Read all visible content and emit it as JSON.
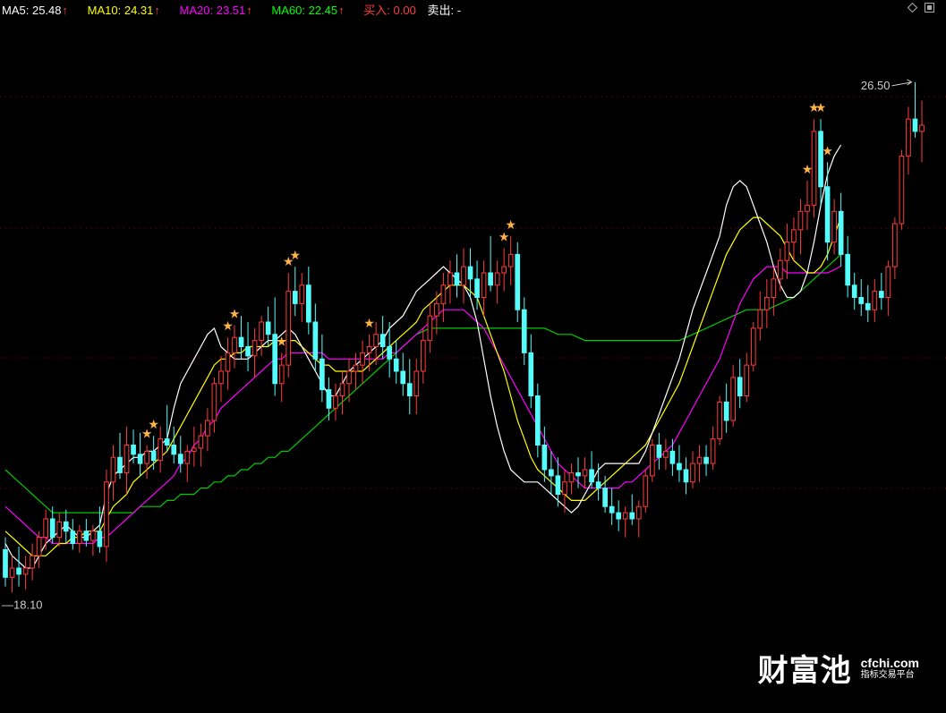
{
  "header": {
    "ma5": {
      "label": "MA5:",
      "value": "25.48",
      "color": "#ffffff"
    },
    "ma10": {
      "label": "MA10:",
      "value": "24.31",
      "color": "#ffff00"
    },
    "ma20": {
      "label": "MA20:",
      "value": "23.51",
      "color": "#ff00ff"
    },
    "ma60": {
      "label": "MA60:",
      "value": "22.45",
      "color": "#00ff00"
    },
    "buy": {
      "label": "买入:",
      "value": "0.00",
      "color": "#ff3b3b"
    },
    "sell": {
      "label": "卖出:",
      "value": "-",
      "color": "#ffffff"
    },
    "arrow_glyph": "↑"
  },
  "watermark": {
    "name": "财富池",
    "site": "cfchi.com",
    "tagline": "指标交易平台"
  },
  "colors": {
    "up": "#ff3b3b",
    "down": "#54fcfc",
    "ma5": "#ffffff",
    "ma10": "#ffff00",
    "ma20": "#ff00ff",
    "ma60": "#00cc00",
    "grid": "#8b0000",
    "marker": "#ffb347"
  },
  "chart_data": {
    "type": "candlestick",
    "high_label": "26.50",
    "low_label": "18.10",
    "ylim": [
      17.8,
      27.4
    ],
    "candles": [
      {
        "o": 18.9,
        "h": 19.1,
        "l": 18.3,
        "c": 18.45
      },
      {
        "o": 18.45,
        "h": 18.8,
        "l": 18.2,
        "c": 18.6
      },
      {
        "o": 18.6,
        "h": 18.95,
        "l": 18.3,
        "c": 18.5
      },
      {
        "o": 18.5,
        "h": 18.8,
        "l": 18.25,
        "c": 18.6
      },
      {
        "o": 18.6,
        "h": 19.0,
        "l": 18.4,
        "c": 18.8
      },
      {
        "o": 18.8,
        "h": 19.2,
        "l": 18.6,
        "c": 19.1
      },
      {
        "o": 19.1,
        "h": 19.55,
        "l": 18.9,
        "c": 19.4
      },
      {
        "o": 19.4,
        "h": 19.6,
        "l": 19.0,
        "c": 19.1
      },
      {
        "o": 19.1,
        "h": 19.5,
        "l": 18.95,
        "c": 19.35
      },
      {
        "o": 19.35,
        "h": 19.55,
        "l": 19.0,
        "c": 19.2
      },
      {
        "o": 19.2,
        "h": 19.4,
        "l": 18.9,
        "c": 19.0
      },
      {
        "o": 19.0,
        "h": 19.3,
        "l": 18.85,
        "c": 19.2
      },
      {
        "o": 19.2,
        "h": 19.4,
        "l": 18.95,
        "c": 19.05
      },
      {
        "o": 19.05,
        "h": 19.3,
        "l": 18.8,
        "c": 19.2
      },
      {
        "o": 19.2,
        "h": 19.6,
        "l": 18.85,
        "c": 18.95
      },
      {
        "o": 18.95,
        "h": 20.2,
        "l": 18.7,
        "c": 20.0
      },
      {
        "o": 20.0,
        "h": 20.6,
        "l": 19.7,
        "c": 20.4
      },
      {
        "o": 20.4,
        "h": 20.8,
        "l": 20.05,
        "c": 20.15
      },
      {
        "o": 20.15,
        "h": 20.9,
        "l": 19.8,
        "c": 20.6
      },
      {
        "o": 20.6,
        "h": 20.85,
        "l": 20.3,
        "c": 20.45
      },
      {
        "o": 20.45,
        "h": 20.8,
        "l": 20.1,
        "c": 20.3
      },
      {
        "o": 20.3,
        "h": 20.6,
        "l": 20.05,
        "c": 20.5
      },
      {
        "o": 20.5,
        "h": 20.75,
        "l": 20.2,
        "c": 20.35
      },
      {
        "o": 20.35,
        "h": 20.9,
        "l": 20.15,
        "c": 20.7
      },
      {
        "o": 20.7,
        "h": 21.25,
        "l": 20.5,
        "c": 20.6
      },
      {
        "o": 20.6,
        "h": 20.9,
        "l": 20.3,
        "c": 20.45
      },
      {
        "o": 20.45,
        "h": 20.75,
        "l": 20.15,
        "c": 20.3
      },
      {
        "o": 20.3,
        "h": 20.6,
        "l": 20.0,
        "c": 20.5
      },
      {
        "o": 20.5,
        "h": 20.9,
        "l": 20.25,
        "c": 20.55
      },
      {
        "o": 20.55,
        "h": 20.95,
        "l": 20.25,
        "c": 20.75
      },
      {
        "o": 20.75,
        "h": 21.2,
        "l": 20.5,
        "c": 21.0
      },
      {
        "o": 21.0,
        "h": 21.7,
        "l": 20.8,
        "c": 21.6
      },
      {
        "o": 21.6,
        "h": 22.05,
        "l": 21.3,
        "c": 21.8
      },
      {
        "o": 21.8,
        "h": 22.35,
        "l": 21.5,
        "c": 22.1
      },
      {
        "o": 22.1,
        "h": 22.55,
        "l": 21.85,
        "c": 22.35
      },
      {
        "o": 22.35,
        "h": 22.7,
        "l": 22.0,
        "c": 22.2
      },
      {
        "o": 22.2,
        "h": 22.6,
        "l": 21.8,
        "c": 22.05
      },
      {
        "o": 22.05,
        "h": 22.5,
        "l": 21.7,
        "c": 22.3
      },
      {
        "o": 22.3,
        "h": 22.7,
        "l": 22.05,
        "c": 22.6
      },
      {
        "o": 22.6,
        "h": 22.85,
        "l": 22.2,
        "c": 22.4
      },
      {
        "o": 22.4,
        "h": 23.0,
        "l": 21.4,
        "c": 21.6
      },
      {
        "o": 21.6,
        "h": 22.1,
        "l": 21.3,
        "c": 21.9
      },
      {
        "o": 21.9,
        "h": 23.4,
        "l": 21.7,
        "c": 23.1
      },
      {
        "o": 23.1,
        "h": 23.5,
        "l": 22.7,
        "c": 22.9
      },
      {
        "o": 22.9,
        "h": 23.4,
        "l": 22.6,
        "c": 23.2
      },
      {
        "o": 23.2,
        "h": 23.5,
        "l": 22.4,
        "c": 22.6
      },
      {
        "o": 22.6,
        "h": 22.9,
        "l": 21.8,
        "c": 22.0
      },
      {
        "o": 22.0,
        "h": 22.4,
        "l": 21.3,
        "c": 21.5
      },
      {
        "o": 21.5,
        "h": 21.7,
        "l": 21.0,
        "c": 21.2
      },
      {
        "o": 21.2,
        "h": 21.6,
        "l": 21.0,
        "c": 21.4
      },
      {
        "o": 21.4,
        "h": 21.8,
        "l": 21.1,
        "c": 21.6
      },
      {
        "o": 21.6,
        "h": 22.0,
        "l": 21.3,
        "c": 21.8
      },
      {
        "o": 21.8,
        "h": 22.1,
        "l": 21.5,
        "c": 21.9
      },
      {
        "o": 21.9,
        "h": 22.3,
        "l": 21.6,
        "c": 22.1
      },
      {
        "o": 22.1,
        "h": 22.4,
        "l": 21.8,
        "c": 22.2
      },
      {
        "o": 22.2,
        "h": 22.6,
        "l": 21.9,
        "c": 22.4
      },
      {
        "o": 22.4,
        "h": 22.7,
        "l": 22.0,
        "c": 22.2
      },
      {
        "o": 22.2,
        "h": 22.6,
        "l": 21.7,
        "c": 22.0
      },
      {
        "o": 22.0,
        "h": 22.3,
        "l": 21.6,
        "c": 21.8
      },
      {
        "o": 21.8,
        "h": 22.1,
        "l": 21.4,
        "c": 21.6
      },
      {
        "o": 21.6,
        "h": 22.0,
        "l": 21.1,
        "c": 21.4
      },
      {
        "o": 21.4,
        "h": 22.0,
        "l": 21.1,
        "c": 21.8
      },
      {
        "o": 21.8,
        "h": 22.5,
        "l": 21.6,
        "c": 22.3
      },
      {
        "o": 22.3,
        "h": 22.9,
        "l": 22.1,
        "c": 22.7
      },
      {
        "o": 22.7,
        "h": 23.1,
        "l": 22.4,
        "c": 22.9
      },
      {
        "o": 22.9,
        "h": 23.4,
        "l": 22.6,
        "c": 23.2
      },
      {
        "o": 23.2,
        "h": 23.6,
        "l": 22.9,
        "c": 23.4
      },
      {
        "o": 23.4,
        "h": 23.7,
        "l": 23.0,
        "c": 23.2
      },
      {
        "o": 23.2,
        "h": 23.8,
        "l": 22.9,
        "c": 23.5
      },
      {
        "o": 23.5,
        "h": 23.8,
        "l": 23.0,
        "c": 23.3
      },
      {
        "o": 23.3,
        "h": 23.6,
        "l": 22.8,
        "c": 23.0
      },
      {
        "o": 23.0,
        "h": 23.6,
        "l": 22.7,
        "c": 23.4
      },
      {
        "o": 23.4,
        "h": 24.0,
        "l": 23.1,
        "c": 23.2
      },
      {
        "o": 23.2,
        "h": 23.6,
        "l": 22.9,
        "c": 23.4
      },
      {
        "o": 23.4,
        "h": 23.8,
        "l": 23.1,
        "c": 23.5
      },
      {
        "o": 23.5,
        "h": 24.0,
        "l": 23.2,
        "c": 23.7
      },
      {
        "o": 23.7,
        "h": 23.9,
        "l": 22.6,
        "c": 22.8
      },
      {
        "o": 22.8,
        "h": 23.0,
        "l": 21.9,
        "c": 22.1
      },
      {
        "o": 22.1,
        "h": 22.4,
        "l": 21.2,
        "c": 21.4
      },
      {
        "o": 21.4,
        "h": 21.6,
        "l": 20.4,
        "c": 20.6
      },
      {
        "o": 20.6,
        "h": 20.9,
        "l": 20.0,
        "c": 20.2
      },
      {
        "o": 20.2,
        "h": 20.5,
        "l": 19.8,
        "c": 20.1
      },
      {
        "o": 20.1,
        "h": 20.4,
        "l": 19.6,
        "c": 19.8
      },
      {
        "o": 19.8,
        "h": 20.2,
        "l": 19.5,
        "c": 20.0
      },
      {
        "o": 20.0,
        "h": 20.3,
        "l": 19.8,
        "c": 20.15
      },
      {
        "o": 20.15,
        "h": 20.4,
        "l": 19.9,
        "c": 20.1
      },
      {
        "o": 20.1,
        "h": 20.4,
        "l": 19.9,
        "c": 20.2
      },
      {
        "o": 20.2,
        "h": 20.5,
        "l": 19.9,
        "c": 20.0
      },
      {
        "o": 20.0,
        "h": 20.3,
        "l": 19.7,
        "c": 19.9
      },
      {
        "o": 19.9,
        "h": 20.1,
        "l": 19.5,
        "c": 19.6
      },
      {
        "o": 19.6,
        "h": 19.9,
        "l": 19.3,
        "c": 19.5
      },
      {
        "o": 19.5,
        "h": 19.7,
        "l": 19.2,
        "c": 19.4
      },
      {
        "o": 19.4,
        "h": 19.6,
        "l": 19.1,
        "c": 19.5
      },
      {
        "o": 19.5,
        "h": 19.8,
        "l": 19.3,
        "c": 19.4
      },
      {
        "o": 19.4,
        "h": 19.7,
        "l": 19.1,
        "c": 19.6
      },
      {
        "o": 19.6,
        "h": 20.2,
        "l": 19.5,
        "c": 20.1
      },
      {
        "o": 20.1,
        "h": 20.7,
        "l": 20.0,
        "c": 20.6
      },
      {
        "o": 20.6,
        "h": 20.8,
        "l": 20.2,
        "c": 20.4
      },
      {
        "o": 20.4,
        "h": 20.7,
        "l": 20.2,
        "c": 20.5
      },
      {
        "o": 20.5,
        "h": 20.7,
        "l": 20.1,
        "c": 20.3
      },
      {
        "o": 20.3,
        "h": 20.6,
        "l": 20.0,
        "c": 20.2
      },
      {
        "o": 20.2,
        "h": 20.4,
        "l": 19.8,
        "c": 20.0
      },
      {
        "o": 20.0,
        "h": 20.5,
        "l": 19.9,
        "c": 20.3
      },
      {
        "o": 20.3,
        "h": 20.6,
        "l": 20.0,
        "c": 20.4
      },
      {
        "o": 20.4,
        "h": 20.6,
        "l": 20.1,
        "c": 20.3
      },
      {
        "o": 20.3,
        "h": 20.9,
        "l": 20.2,
        "c": 20.7
      },
      {
        "o": 20.7,
        "h": 21.4,
        "l": 20.6,
        "c": 21.3
      },
      {
        "o": 21.3,
        "h": 21.6,
        "l": 20.8,
        "c": 21.0
      },
      {
        "o": 21.0,
        "h": 21.9,
        "l": 20.9,
        "c": 21.7
      },
      {
        "o": 21.7,
        "h": 22.0,
        "l": 21.2,
        "c": 21.4
      },
      {
        "o": 21.4,
        "h": 22.1,
        "l": 21.3,
        "c": 21.9
      },
      {
        "o": 21.9,
        "h": 22.6,
        "l": 21.8,
        "c": 22.5
      },
      {
        "o": 22.5,
        "h": 23.1,
        "l": 22.3,
        "c": 22.8
      },
      {
        "o": 22.8,
        "h": 23.3,
        "l": 22.5,
        "c": 23.0
      },
      {
        "o": 23.0,
        "h": 23.5,
        "l": 22.7,
        "c": 23.3
      },
      {
        "o": 23.3,
        "h": 23.8,
        "l": 23.1,
        "c": 23.6
      },
      {
        "o": 23.6,
        "h": 24.2,
        "l": 23.3,
        "c": 23.9
      },
      {
        "o": 23.9,
        "h": 24.3,
        "l": 23.6,
        "c": 24.1
      },
      {
        "o": 24.1,
        "h": 24.6,
        "l": 23.7,
        "c": 24.4
      },
      {
        "o": 24.4,
        "h": 24.9,
        "l": 24.1,
        "c": 24.5
      },
      {
        "o": 24.5,
        "h": 25.9,
        "l": 24.3,
        "c": 25.7
      },
      {
        "o": 25.7,
        "h": 25.9,
        "l": 24.5,
        "c": 24.8
      },
      {
        "o": 24.8,
        "h": 25.2,
        "l": 23.6,
        "c": 23.9
      },
      {
        "o": 23.9,
        "h": 24.6,
        "l": 23.7,
        "c": 24.4
      },
      {
        "o": 24.4,
        "h": 24.7,
        "l": 23.5,
        "c": 23.7
      },
      {
        "o": 23.7,
        "h": 24.0,
        "l": 23.0,
        "c": 23.2
      },
      {
        "o": 23.2,
        "h": 23.4,
        "l": 22.8,
        "c": 23.0
      },
      {
        "o": 23.0,
        "h": 23.3,
        "l": 22.7,
        "c": 22.9
      },
      {
        "o": 22.9,
        "h": 23.2,
        "l": 22.6,
        "c": 22.8
      },
      {
        "o": 22.8,
        "h": 23.3,
        "l": 22.6,
        "c": 23.1
      },
      {
        "o": 23.1,
        "h": 23.4,
        "l": 22.8,
        "c": 23.0
      },
      {
        "o": 23.0,
        "h": 23.6,
        "l": 22.7,
        "c": 23.5
      },
      {
        "o": 23.5,
        "h": 24.3,
        "l": 23.3,
        "c": 24.2
      },
      {
        "o": 24.2,
        "h": 25.4,
        "l": 24.1,
        "c": 25.3
      },
      {
        "o": 25.3,
        "h": 26.1,
        "l": 25.0,
        "c": 25.9
      },
      {
        "o": 25.9,
        "h": 26.5,
        "l": 25.6,
        "c": 25.7
      },
      {
        "o": 25.7,
        "h": 26.2,
        "l": 25.2,
        "c": 25.8
      }
    ],
    "ma5": [
      19.0,
      18.8,
      18.7,
      18.6,
      18.6,
      18.8,
      19.0,
      19.1,
      19.2,
      19.3,
      19.2,
      19.1,
      19.1,
      19.2,
      19.3,
      19.8,
      20.1,
      20.2,
      20.3,
      20.4,
      20.4,
      20.5,
      20.5,
      20.6,
      20.7,
      21.2,
      21.6,
      21.8,
      22.0,
      22.2,
      22.4,
      22.5,
      22.2,
      22.1,
      22.0,
      22.0,
      22.0,
      22.1,
      22.2,
      22.3,
      22.3,
      22.4,
      22.5,
      22.4,
      22.2,
      22.0,
      21.8,
      21.6,
      21.4,
      21.4,
      21.6,
      21.8,
      21.9,
      22.0,
      22.1,
      22.2,
      22.3,
      22.5,
      22.6,
      22.7,
      22.9,
      23.1,
      23.2,
      23.3,
      23.4,
      23.5,
      23.4,
      23.3,
      23.2,
      23.0,
      22.6,
      22.0,
      21.4,
      20.9,
      20.5,
      20.2,
      20.1,
      20.0,
      20.0,
      20.0,
      19.9,
      19.8,
      19.7,
      19.6,
      19.5,
      19.6,
      19.8,
      20.0,
      20.2,
      20.3,
      20.3,
      20.3,
      20.3,
      20.3,
      20.3,
      20.5,
      20.8,
      21.1,
      21.4,
      21.7,
      22.0,
      22.4,
      22.8,
      23.1,
      23.4,
      23.7,
      24.0,
      24.5,
      24.8,
      24.9,
      24.8,
      24.5,
      24.2,
      23.9,
      23.5,
      23.2,
      23.0,
      23.0,
      23.1,
      23.4,
      23.9,
      24.5,
      25.0,
      25.3,
      25.48
    ],
    "ma10": [
      19.2,
      19.1,
      19.0,
      18.9,
      18.8,
      18.8,
      18.8,
      18.9,
      19.0,
      19.0,
      19.1,
      19.1,
      19.2,
      19.2,
      19.2,
      19.4,
      19.6,
      19.7,
      19.8,
      20.0,
      20.1,
      20.2,
      20.3,
      20.4,
      20.5,
      20.7,
      20.9,
      21.1,
      21.3,
      21.5,
      21.7,
      21.9,
      22.0,
      22.0,
      22.1,
      22.1,
      22.2,
      22.2,
      22.2,
      22.2,
      22.3,
      22.3,
      22.3,
      22.3,
      22.2,
      22.1,
      22.0,
      21.9,
      21.9,
      21.8,
      21.8,
      21.8,
      21.8,
      21.8,
      21.9,
      22.0,
      22.1,
      22.2,
      22.3,
      22.4,
      22.5,
      22.6,
      22.8,
      22.9,
      23.0,
      23.1,
      23.2,
      23.2,
      23.2,
      23.1,
      23.0,
      22.7,
      22.4,
      22.1,
      21.8,
      21.4,
      21.0,
      20.7,
      20.4,
      20.2,
      20.1,
      20.0,
      19.9,
      19.8,
      19.7,
      19.7,
      19.7,
      19.8,
      19.9,
      20.0,
      20.1,
      20.2,
      20.3,
      20.4,
      20.5,
      20.6,
      20.8,
      21.0,
      21.2,
      21.4,
      21.6,
      21.9,
      22.2,
      22.5,
      22.8,
      23.1,
      23.4,
      23.7,
      23.9,
      24.1,
      24.2,
      24.3,
      24.3,
      24.2,
      24.1,
      24.0,
      23.8,
      23.6,
      23.5,
      23.4,
      23.4,
      23.5,
      23.7,
      24.0,
      24.31
    ],
    "ma20": [
      19.6,
      19.5,
      19.4,
      19.3,
      19.2,
      19.1,
      19.1,
      19.0,
      19.0,
      19.0,
      19.0,
      19.0,
      19.0,
      19.0,
      19.1,
      19.1,
      19.2,
      19.3,
      19.4,
      19.5,
      19.6,
      19.7,
      19.8,
      19.9,
      20.0,
      20.1,
      20.3,
      20.4,
      20.6,
      20.7,
      20.9,
      21.0,
      21.2,
      21.3,
      21.4,
      21.5,
      21.6,
      21.7,
      21.8,
      21.9,
      22.0,
      22.0,
      22.1,
      22.1,
      22.1,
      22.1,
      22.1,
      22.1,
      22.0,
      22.0,
      22.0,
      22.0,
      22.0,
      22.0,
      22.0,
      22.0,
      22.0,
      22.1,
      22.1,
      22.2,
      22.3,
      22.4,
      22.5,
      22.6,
      22.7,
      22.8,
      22.8,
      22.8,
      22.8,
      22.7,
      22.6,
      22.5,
      22.3,
      22.1,
      21.9,
      21.7,
      21.5,
      21.3,
      21.1,
      20.9,
      20.7,
      20.5,
      20.3,
      20.2,
      20.1,
      20.0,
      19.9,
      19.9,
      19.9,
      19.9,
      19.9,
      19.9,
      20.0,
      20.0,
      20.1,
      20.2,
      20.3,
      20.4,
      20.5,
      20.6,
      20.8,
      21.0,
      21.2,
      21.4,
      21.6,
      21.8,
      22.0,
      22.3,
      22.6,
      22.9,
      23.1,
      23.3,
      23.4,
      23.5,
      23.5,
      23.5,
      23.4,
      23.4,
      23.4,
      23.4,
      23.4,
      23.4,
      23.4,
      23.45,
      23.51
    ],
    "ma60": [
      20.2,
      20.1,
      20.0,
      19.9,
      19.8,
      19.7,
      19.6,
      19.5,
      19.5,
      19.5,
      19.5,
      19.5,
      19.5,
      19.5,
      19.5,
      19.5,
      19.5,
      19.5,
      19.5,
      19.5,
      19.6,
      19.6,
      19.6,
      19.6,
      19.7,
      19.7,
      19.8,
      19.8,
      19.8,
      19.9,
      19.9,
      20.0,
      20.0,
      20.1,
      20.1,
      20.2,
      20.2,
      20.3,
      20.3,
      20.4,
      20.4,
      20.5,
      20.5,
      20.6,
      20.7,
      20.8,
      20.9,
      21.0,
      21.1,
      21.2,
      21.3,
      21.4,
      21.5,
      21.6,
      21.7,
      21.8,
      21.9,
      22.0,
      22.1,
      22.2,
      22.3,
      22.4,
      22.45,
      22.5,
      22.5,
      22.5,
      22.5,
      22.5,
      22.5,
      22.5,
      22.5,
      22.5,
      22.5,
      22.5,
      22.5,
      22.5,
      22.5,
      22.5,
      22.5,
      22.5,
      22.5,
      22.45,
      22.4,
      22.4,
      22.4,
      22.35,
      22.3,
      22.3,
      22.3,
      22.3,
      22.3,
      22.3,
      22.3,
      22.3,
      22.3,
      22.3,
      22.3,
      22.3,
      22.3,
      22.3,
      22.3,
      22.35,
      22.4,
      22.45,
      22.5,
      22.55,
      22.6,
      22.65,
      22.7,
      22.75,
      22.8,
      22.8,
      22.8,
      22.8,
      22.85,
      22.9,
      22.95,
      23.0,
      23.1,
      23.2,
      23.3,
      23.4,
      23.5,
      23.6,
      23.7
    ],
    "markers": [
      21,
      22,
      33,
      34,
      41,
      42,
      43,
      54,
      74,
      75,
      119,
      120,
      121,
      122,
      150,
      151
    ]
  }
}
